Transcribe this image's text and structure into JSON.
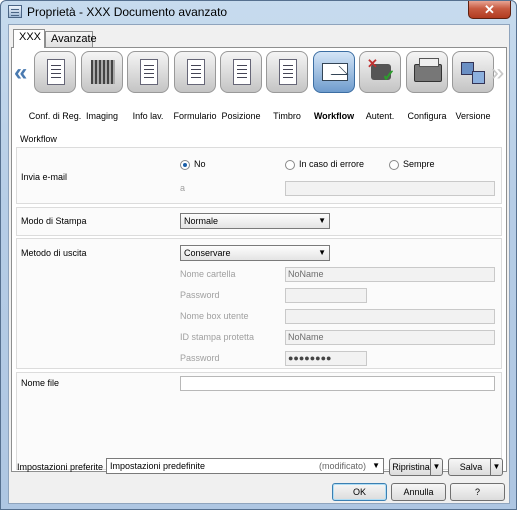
{
  "window": {
    "title": "Proprietà - XXX Documento avanzato",
    "close_glyph": "✕"
  },
  "tabs": [
    {
      "label": "XXX"
    },
    {
      "label": "Avanzate"
    }
  ],
  "toolbar": {
    "left_arrow": "«",
    "right_arrow": "»",
    "items": [
      {
        "label": "Conf. di Reg.",
        "icon": "settings-doc-icon"
      },
      {
        "label": "Imaging",
        "icon": "imaging-icon"
      },
      {
        "label": "Info lav.",
        "icon": "job-info-icon"
      },
      {
        "label": "Formulario",
        "icon": "form-icon"
      },
      {
        "label": "Posizione",
        "icon": "position-icon"
      },
      {
        "label": "Timbro",
        "icon": "stamp-icon"
      },
      {
        "label": "Workflow",
        "icon": "workflow-icon",
        "active": true
      },
      {
        "label": "Autent.",
        "icon": "authentication-icon"
      },
      {
        "label": "Configura",
        "icon": "configure-icon"
      },
      {
        "label": "Versione",
        "icon": "version-icon"
      }
    ]
  },
  "workflow": {
    "section_title": "Workflow",
    "email": {
      "label": "Invia e-mail",
      "options": [
        "No",
        "In caso di errore",
        "Sempre"
      ],
      "selected": "No",
      "to_label": "a",
      "to_value": ""
    },
    "print_mode": {
      "label": "Modo di Stampa",
      "value": "Normale"
    },
    "output": {
      "label": "Metodo di uscita",
      "value": "Conservare",
      "fields": [
        {
          "label": "Nome cartella",
          "value": "NoName"
        },
        {
          "label": "Password",
          "value": ""
        },
        {
          "label": "Nome box utente",
          "value": ""
        },
        {
          "label": "ID stampa protetta",
          "value": "NoName"
        },
        {
          "label": "Password",
          "value": "●●●●●●●●"
        }
      ]
    },
    "file_name": {
      "label": "Nome file",
      "value": ""
    }
  },
  "favorites": {
    "label": "Impostazioni preferite",
    "value": "Impostazioni predefinite",
    "modified": "(modificato)",
    "restore": "Ripristina",
    "save": "Salva"
  },
  "buttons": {
    "ok": "OK",
    "cancel": "Annulla",
    "help": "?"
  }
}
